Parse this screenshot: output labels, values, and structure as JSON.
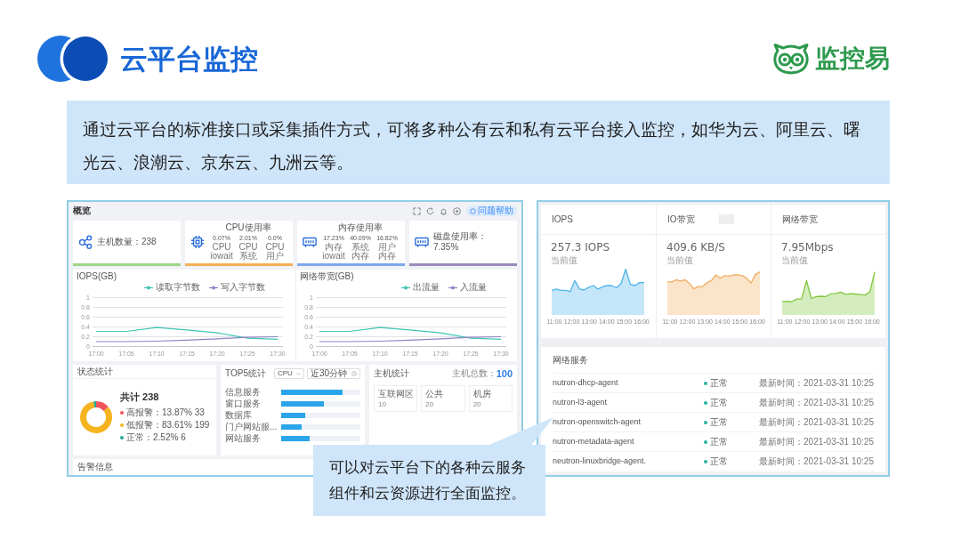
{
  "header": {
    "title": "云平台监控",
    "brand": "监控易"
  },
  "intro": "通过云平台的标准接口或采集插件方式，可将多种公有云和私有云平台接入监控，如华为云、阿里云、曙光云、浪潮云、京东云、九洲云等。",
  "overview": {
    "title": "概览",
    "help_button": "问题帮助",
    "stat_cards": [
      {
        "kind": "single",
        "label": "主机数量：238",
        "color": "#9ed68b"
      },
      {
        "kind": "multi",
        "title": "CPU使用率",
        "metrics": [
          {
            "value": "0.07%",
            "label": "CPU iowait"
          },
          {
            "value": "2.01%",
            "label": "CPU系统"
          },
          {
            "value": "0.0%",
            "label": "CPU用户"
          }
        ],
        "color": "#f5b155"
      },
      {
        "kind": "multi",
        "title": "内存使用率",
        "metrics": [
          {
            "value": "17.23%",
            "label": "内存iowait"
          },
          {
            "value": "40.09%",
            "label": "系统内存"
          },
          {
            "value": "16.82%",
            "label": "用户内存"
          }
        ],
        "color": "#7ea8ee"
      },
      {
        "kind": "single",
        "label": "磁盘使用率：7.35%",
        "color": "#9c8cc0"
      }
    ],
    "trend_charts": [
      {
        "chart_data": {
          "type": "line",
          "title": "IOPS(GB)",
          "categories": [
            "17:00",
            "17:05",
            "17:10",
            "17:15",
            "17:20",
            "17:25",
            "17:30"
          ],
          "ylim": [
            0,
            1
          ],
          "yticks": [
            0,
            0.2,
            0.4,
            0.6,
            0.8,
            1
          ],
          "grid": true,
          "legend": "top-right",
          "series": [
            {
              "name": "读取字节数",
              "color": "#3ec5b4",
              "values": [
                0.3,
                0.3,
                0.38,
                0.33,
                0.27,
                0.16,
                0.14
              ]
            },
            {
              "name": "写入字节数",
              "color": "#8d84c7",
              "values": [
                0.09,
                0.09,
                0.1,
                0.12,
                0.15,
                0.18,
                0.19
              ]
            }
          ]
        }
      },
      {
        "chart_data": {
          "type": "line",
          "title": "网络带宽(GB)",
          "categories": [
            "17:00",
            "17:05",
            "17:10",
            "17:15",
            "17:20",
            "17:25",
            "17:30"
          ],
          "ylim": [
            0,
            1
          ],
          "yticks": [
            0,
            0.2,
            0.4,
            0.6,
            0.8,
            1
          ],
          "grid": true,
          "legend": "top-right",
          "series": [
            {
              "name": "出流量",
              "color": "#3ec5b4",
              "values": [
                0.3,
                0.3,
                0.38,
                0.33,
                0.27,
                0.16,
                0.14
              ]
            },
            {
              "name": "入流量",
              "color": "#8d84c7",
              "values": [
                0.09,
                0.09,
                0.1,
                0.12,
                0.15,
                0.18,
                0.19
              ]
            }
          ]
        }
      }
    ],
    "status": {
      "title": "状态统计",
      "total": "共计 238",
      "chart_data": {
        "type": "donut",
        "categories": [
          "高报警",
          "低报警",
          "正常"
        ],
        "values": [
          13.87,
          83.61,
          2.52
        ],
        "colors": [
          "#f0545c",
          "#f5b320",
          "#24a794"
        ]
      },
      "legend_values": [
        "：13.87% 33",
        "：83.61% 199",
        "：2.52% 6"
      ]
    },
    "top5": {
      "title": "TOP5统计",
      "metric_select": "CPU",
      "range_select": "近30分钟",
      "bars": [
        {
          "label": "信息服务",
          "level": 0.78
        },
        {
          "label": "窗口服务",
          "level": 0.54
        },
        {
          "label": "数据库",
          "level": 0.3
        },
        {
          "label": "门户网站服...",
          "level": 0.26
        },
        {
          "label": "网站服务",
          "level": 0.36
        }
      ]
    },
    "hosts": {
      "title": "主机统计",
      "total_label": "主机总数：",
      "total": "100",
      "zones": [
        {
          "name": "互联网区",
          "count": "10"
        },
        {
          "name": "公共",
          "count": "20"
        },
        {
          "name": "机房",
          "count": "20"
        }
      ]
    },
    "alerts": {
      "title": "告警信息"
    }
  },
  "monitor": {
    "metrics": [
      {
        "title": "IOPS",
        "blank_chip": false,
        "value": "257.3 IOPS",
        "caption": "当前值",
        "color": "#4fb4ea",
        "time_labels": [
          "11:00",
          "12:00",
          "13:00",
          "14:00",
          "15:00",
          "16:00"
        ]
      },
      {
        "title": "IO带宽",
        "blank_chip": true,
        "value": "409.6 KB/S",
        "caption": "当前值",
        "color": "#f0ad5e",
        "time_labels": [
          "11:00",
          "12:00",
          "13:00",
          "14:00",
          "15:00",
          "16:00"
        ]
      },
      {
        "title": "网络带宽",
        "blank_chip": false,
        "value": "7.95Mbps",
        "caption": "当前值",
        "color": "#7fc73a",
        "time_labels": [
          "11:00",
          "12:00",
          "13:00",
          "14:00",
          "15:00",
          "16:00"
        ]
      }
    ],
    "services": {
      "title": "网络服务",
      "rows": [
        {
          "name": "nutron-dhcp-agent",
          "status": "正常",
          "color": "#26b3a0",
          "updated": "最新时间：2021-03-31 10:25"
        },
        {
          "name": "nutron-l3-agent",
          "status": "正常",
          "color": "#26b3a0",
          "updated": "最新时间：2021-03-31 10:25"
        },
        {
          "name": "nutron-openswitch-agent",
          "status": "正常",
          "color": "#26b3a0",
          "updated": "最新时间：2021-03-31 10:25"
        },
        {
          "name": "nutron-metadata-agent",
          "status": "正常",
          "color": "#26b3a0",
          "updated": "最新时间：2021-03-31 10:25"
        },
        {
          "name": "neutron-linuxbridge-agent.",
          "status": "正常",
          "color": "#26b3a0",
          "updated": "最新时间：2021-03-31 10:25"
        }
      ]
    }
  },
  "callout": "可以对云平台下的各种云服务组件和云资源进行全面监控。"
}
